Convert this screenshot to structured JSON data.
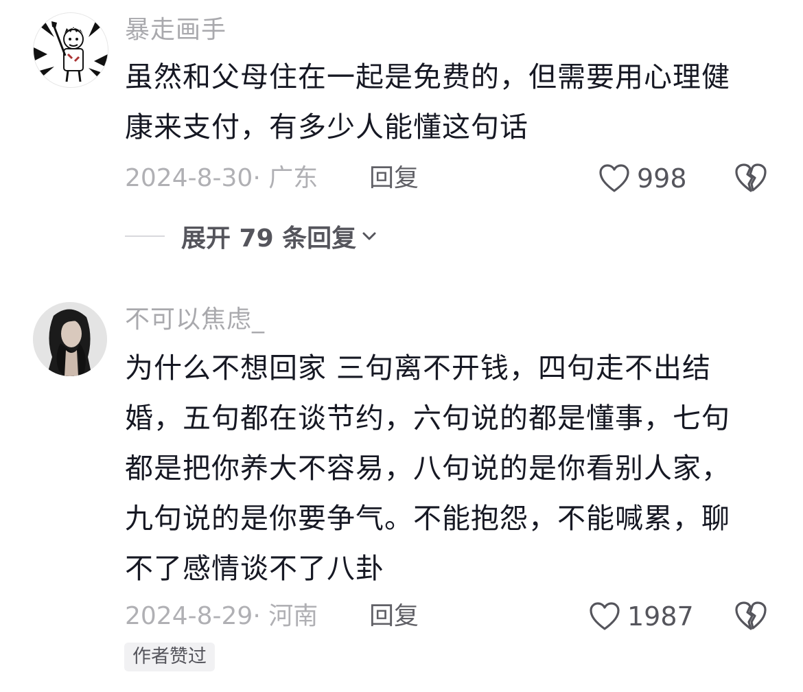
{
  "comments": [
    {
      "username": "暴走画手",
      "text_lines": [
        "虽然和父母住在一起是免费的，但需要用心理健",
        "康来支付，有多少人能懂这句话"
      ],
      "date": "2024-8-30",
      "separator": "·",
      "location": "广东",
      "reply_label": "回复",
      "like_count": "998",
      "expand_label": "展开 79 条回复",
      "avatar_icon": "cartoon-painter-avatar",
      "like_icon": "heart-outline-icon",
      "dislike_icon": "broken-heart-icon"
    },
    {
      "username": "不可以焦虑_",
      "text_lines": [
        "为什么不想回家 三句离不开钱，四句走不出结",
        "婚，五句都在谈节约，六句说的都是懂事，七句",
        "都是把你养大不容易，八句说的是你看别人家，",
        "九句说的是你要争气。不能抱怨，不能喊累，聊",
        "不了感情谈不了八卦"
      ],
      "date": "2024-8-29",
      "separator": "·",
      "location": "河南",
      "reply_label": "回复",
      "like_count": "1987",
      "badge": "作者赞过",
      "avatar_icon": "dark-hair-portrait-avatar",
      "like_icon": "heart-outline-icon",
      "dislike_icon": "broken-heart-icon"
    }
  ],
  "colors": {
    "text_primary": "#161823",
    "text_secondary": "#a9a9ad",
    "icon": "#55555c",
    "badge_bg": "#f1f1f3"
  }
}
